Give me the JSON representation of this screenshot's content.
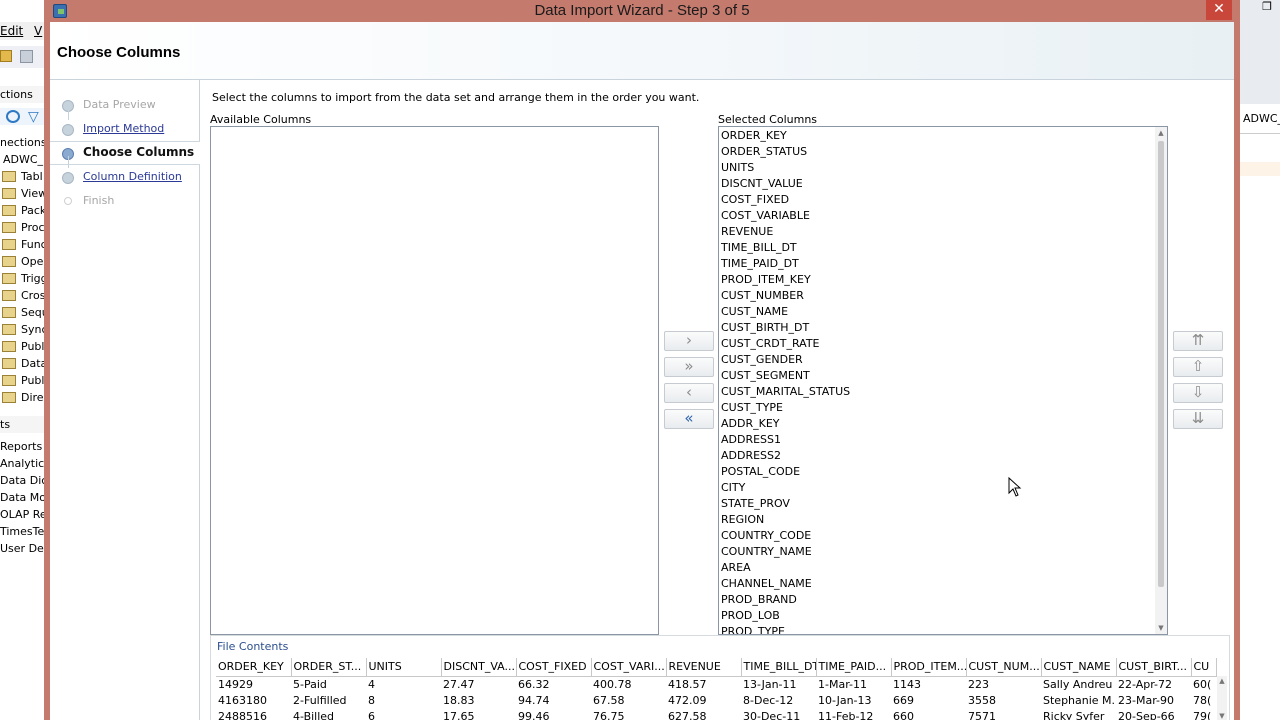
{
  "background_app": {
    "menu": {
      "edit": "Edit",
      "view": "V"
    },
    "connections_header": "ctions",
    "tree_root_label": "nections",
    "connection_name": "ADWC_",
    "tree_items": [
      "Tabl",
      "View",
      "Pack",
      "Proc",
      "Func",
      "Ope",
      "Trigg",
      "Cros",
      "Sequ",
      "Sync",
      "Publ",
      "Data",
      "Publ",
      "Dire"
    ],
    "reports_header": "ts",
    "report_items": [
      "Reports",
      "Analytic",
      "Data Dic",
      "Data Mo",
      "OLAP Re",
      "TimesTe",
      "User Def"
    ],
    "right_panel_tab": "ADWC_H"
  },
  "dialog": {
    "title": "Data Import Wizard - Step 3 of 5",
    "close_glyph": "✕",
    "header_title": "Choose Columns",
    "steps": [
      {
        "label": "Data Preview",
        "state": "disabled"
      },
      {
        "label": "Import Method",
        "state": "link"
      },
      {
        "label": "Choose Columns",
        "state": "current"
      },
      {
        "label": "Column Definition",
        "state": "link"
      },
      {
        "label": "Finish",
        "state": "disabled"
      }
    ],
    "instruction": "Select the columns to import from the data set and arrange them in the order you want.",
    "available_label": "Available Columns",
    "selected_label": "Selected Columns",
    "selected_columns": [
      "ORDER_KEY",
      "ORDER_STATUS",
      "UNITS",
      "DISCNT_VALUE",
      "COST_FIXED",
      "COST_VARIABLE",
      "REVENUE",
      "TIME_BILL_DT",
      "TIME_PAID_DT",
      "PROD_ITEM_KEY",
      "CUST_NUMBER",
      "CUST_NAME",
      "CUST_BIRTH_DT",
      "CUST_CRDT_RATE",
      "CUST_GENDER",
      "CUST_SEGMENT",
      "CUST_MARITAL_STATUS",
      "CUST_TYPE",
      "ADDR_KEY",
      "ADDRESS1",
      "ADDRESS2",
      "POSTAL_CODE",
      "CITY",
      "STATE_PROV",
      "REGION",
      "COUNTRY_CODE",
      "COUNTRY_NAME",
      "AREA",
      "CHANNEL_NAME",
      "PROD_BRAND",
      "PROD_LOB",
      "PROD_TYPE"
    ],
    "move_buttons": {
      "move_right": "›",
      "move_all_right": "»",
      "move_left": "‹",
      "move_all_left": "«"
    },
    "order_buttons": {
      "top": "⇈",
      "up": "⇧",
      "down": "⇩",
      "bottom": "⇊"
    },
    "file_contents": {
      "label": "File Contents",
      "headers": [
        "ORDER_KEY",
        "ORDER_ST...",
        "UNITS",
        "DISCNT_VA...",
        "COST_FIXED",
        "COST_VARI...",
        "REVENUE",
        "TIME_BILL_DT",
        "TIME_PAID...",
        "PROD_ITEM...",
        "CUST_NUM...",
        "CUST_NAME",
        "CUST_BIRT...",
        "CU"
      ],
      "rows": [
        [
          "14929",
          "5-Paid",
          "4",
          "27.47",
          "66.32",
          "400.78",
          "418.57",
          "13-Jan-11",
          "1-Mar-11",
          "1143",
          "223",
          "Sally Andreu",
          "22-Apr-72",
          "60("
        ],
        [
          "4163180",
          "2-Fulfilled",
          "8",
          "18.83",
          "94.74",
          "67.58",
          "472.09",
          "8-Dec-12",
          "10-Jan-13",
          "669",
          "3558",
          "Stephanie M...",
          "23-Mar-90",
          "78("
        ],
        [
          "2488516",
          "4-Billed",
          "6",
          "17.65",
          "99.46",
          "76.75",
          "627.58",
          "30-Dec-11",
          "11-Feb-12",
          "660",
          "7571",
          "Ricky Syfer",
          "20-Sep-66",
          "79("
        ]
      ]
    }
  },
  "colors": {
    "dialog_frame": "#c47b6e",
    "close_button": "#c9463b",
    "link": "#2b3a96",
    "active_arrow": "#2f66b0"
  }
}
